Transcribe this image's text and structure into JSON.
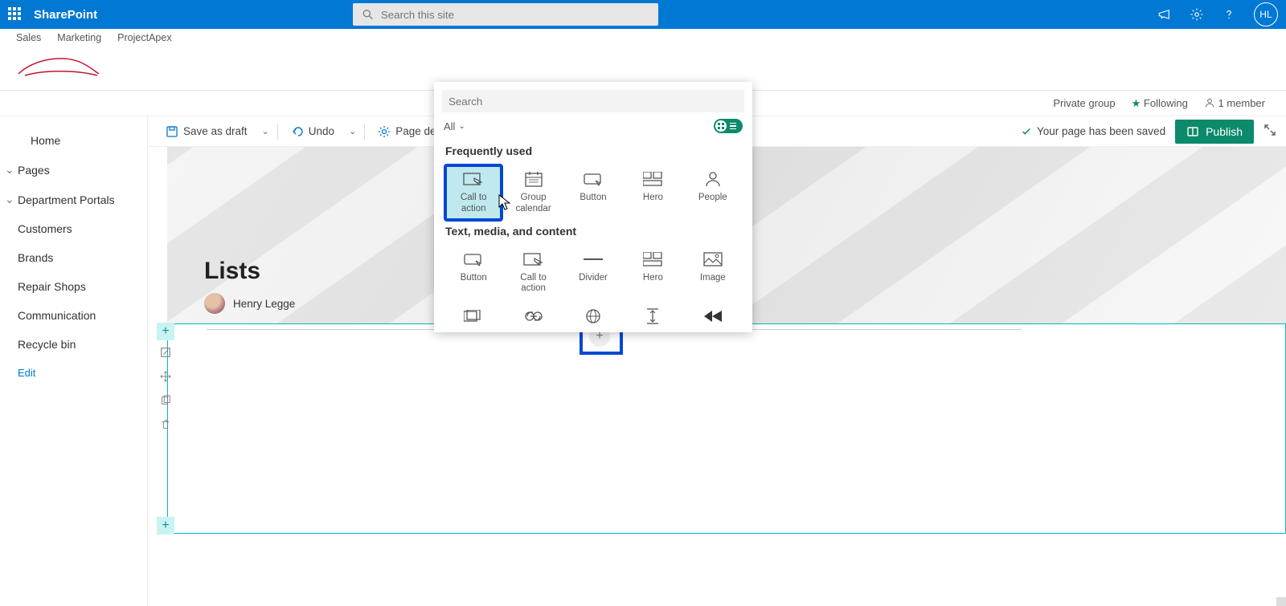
{
  "top": {
    "brand": "SharePoint",
    "search_placeholder": "Search this site",
    "avatar": "HL"
  },
  "site_tabs": [
    "Sales",
    "Marketing",
    "ProjectApex"
  ],
  "info": {
    "group": "Private group",
    "following": "Following",
    "members": "1 member"
  },
  "leftnav": {
    "items": [
      {
        "label": "Home",
        "expandable": false
      },
      {
        "label": "Pages",
        "expandable": true
      },
      {
        "label": "Department Portals",
        "expandable": true
      },
      {
        "label": "Customers",
        "expandable": false
      },
      {
        "label": "Brands",
        "expandable": false
      },
      {
        "label": "Repair Shops",
        "expandable": false
      },
      {
        "label": "Communication",
        "expandable": false
      },
      {
        "label": "Recycle bin",
        "expandable": false
      }
    ],
    "edit": "Edit"
  },
  "toolbar": {
    "save": "Save as draft",
    "undo": "Undo",
    "page_details": "Page details",
    "saved_msg": "Your page has been saved",
    "publish": "Publish"
  },
  "page": {
    "title": "Lists",
    "author": "Henry Legge"
  },
  "picker": {
    "search_placeholder": "Search",
    "filter": "All",
    "sections": {
      "freq": "Frequently used",
      "text": "Text, media, and content"
    },
    "freq_items": [
      "Call to action",
      "Group calendar",
      "Button",
      "Hero",
      "People"
    ],
    "text_items": [
      "Button",
      "Call to action",
      "Divider",
      "Hero",
      "Image"
    ]
  }
}
